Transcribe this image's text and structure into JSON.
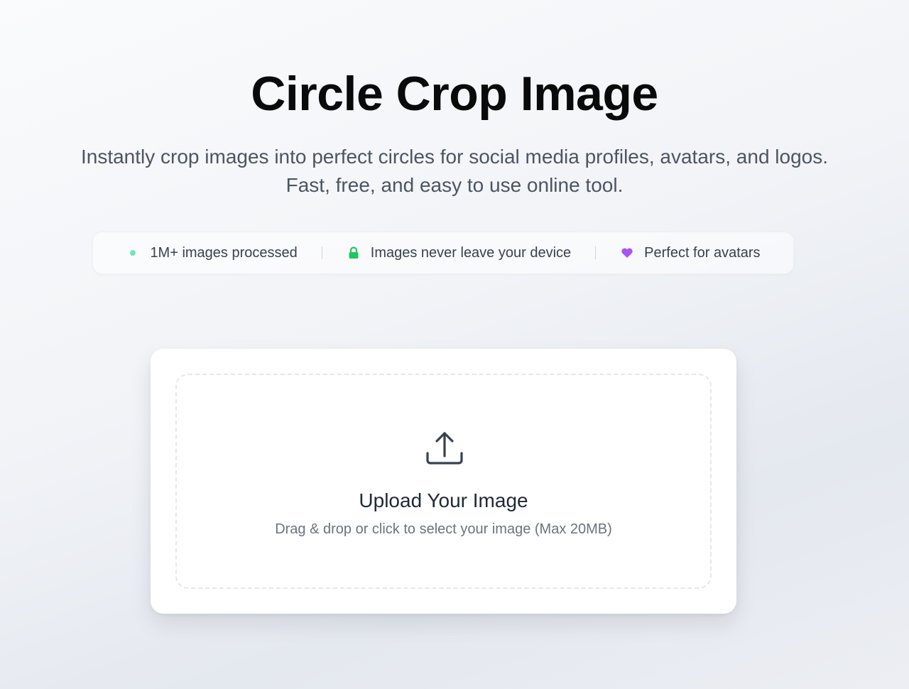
{
  "hero": {
    "title": "Circle Crop Image",
    "subtitle": "Instantly crop images into perfect circles for social media profiles, avatars, and logos. Fast, free, and easy to use online tool."
  },
  "features": [
    {
      "icon": "status-dot-icon",
      "label": "1M+ images processed",
      "color": "#6ee7b7"
    },
    {
      "icon": "lock-icon",
      "label": "Images never leave your device",
      "color": "#22c55e"
    },
    {
      "icon": "heart-icon",
      "label": "Perfect for avatars",
      "color": "#a855f7"
    }
  ],
  "upload": {
    "icon": "upload-icon",
    "title": "Upload Your Image",
    "subtitle": "Drag & drop or click to select your image (Max 20MB)"
  },
  "colors": {
    "title": "#0a0a0a",
    "text_muted": "#4b5563",
    "dropzone_border": "#e5e7eb"
  }
}
